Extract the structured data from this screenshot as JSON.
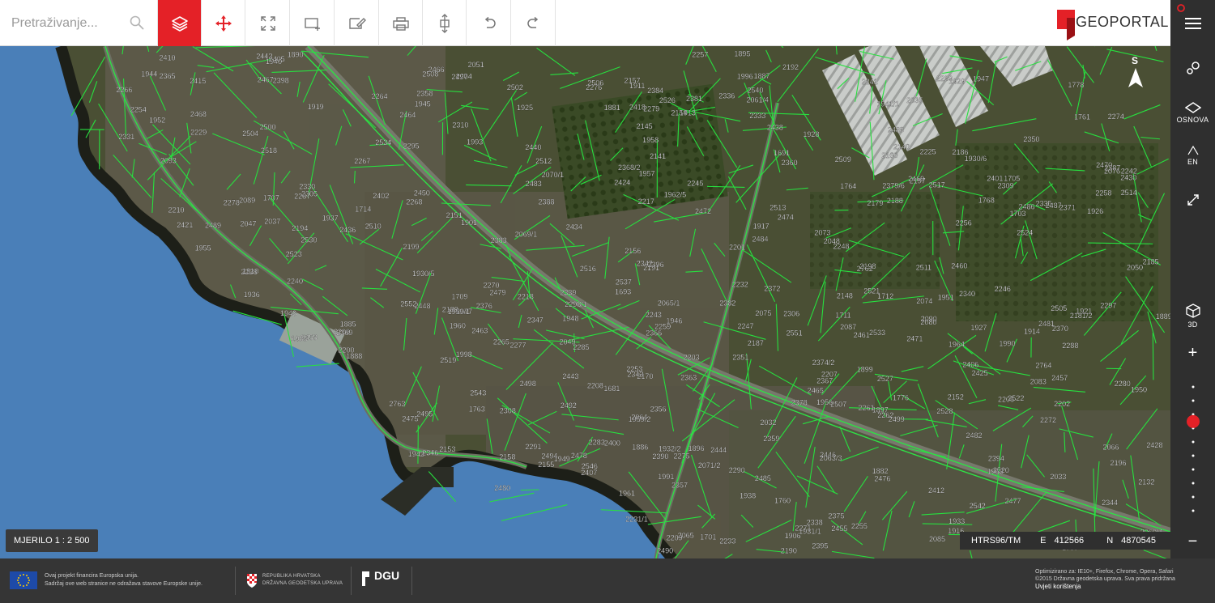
{
  "search": {
    "placeholder": "Pretraživanje..."
  },
  "toolbar": {
    "tools": [
      {
        "name": "layers",
        "active": true
      },
      {
        "name": "move"
      },
      {
        "name": "fullscreen"
      },
      {
        "name": "add-point"
      },
      {
        "name": "edit"
      },
      {
        "name": "print"
      },
      {
        "name": "measure"
      },
      {
        "name": "undo"
      },
      {
        "name": "redo"
      }
    ]
  },
  "logo": {
    "text": "GEOPORTAL",
    "accent": "#e42127"
  },
  "sidebar": {
    "north_label": "S",
    "osnova_label": "OSNOVA",
    "lang_label": "EN",
    "three_d_label": "3D",
    "zoom_in": "+",
    "zoom_out": "−",
    "zoom_level": 0.72
  },
  "map": {
    "scale_label": "MJERILO 1 : 2 500",
    "projection": "HTRS96/TM",
    "e_label": "E",
    "e_value": "412566",
    "n_label": "N",
    "n_value": "4870545",
    "parcel_labels": [
      "1895",
      "2154",
      "2179",
      "2155",
      "2148",
      "2145",
      "2140",
      "2141",
      "2132",
      "2158",
      "2093",
      "2090",
      "2089",
      "2087",
      "2085",
      "2083",
      "2080",
      "2077",
      "2076",
      "2075",
      "2074",
      "2073",
      "2071/2",
      "2070/1",
      "2069/1",
      "2066",
      "2061/4",
      "2049",
      "2048",
      "2047",
      "2051",
      "2050",
      "1966",
      "1964",
      "1963",
      "1961",
      "1958",
      "1957",
      "1952",
      "1948",
      "1943",
      "1944",
      "1939",
      "1940",
      "1933",
      "1929",
      "1928",
      "1927",
      "1926",
      "1925",
      "1921",
      "1919",
      "1917",
      "1916",
      "1914",
      "1913",
      "1911",
      "1910",
      "1906",
      "1901",
      "1899",
      "1896",
      "1897",
      "1887",
      "1888",
      "1889",
      "1890",
      "1881",
      "1882",
      "1885",
      "1886",
      "1938",
      "1937",
      "1936",
      "1930/5",
      "1932/2",
      "1931/1",
      "1930/6",
      "2170",
      "2160",
      "2157",
      "2156",
      "2153",
      "2152",
      "2151",
      "2181/2",
      "2185",
      "2186",
      "2187",
      "2188",
      "2189",
      "2190",
      "2191",
      "2192",
      "2194",
      "2196",
      "2197",
      "2198",
      "2199",
      "2200",
      "2201",
      "2202",
      "2203",
      "2204",
      "2205",
      "2206",
      "2207",
      "2208",
      "2209",
      "2210",
      "2217",
      "2218",
      "2225",
      "2228",
      "2229",
      "2231/1",
      "2232",
      "2233",
      "2240",
      "2241",
      "2242",
      "2243",
      "2244",
      "2245",
      "2246",
      "2247",
      "2248",
      "2253",
      "2254",
      "2255",
      "2256",
      "2257",
      "2258",
      "2259",
      "2261",
      "2262",
      "2264",
      "2265",
      "2266",
      "2267",
      "2268",
      "2270",
      "2271",
      "2272",
      "2274",
      "2275",
      "2276",
      "2277",
      "2278",
      "2279",
      "2280",
      "2283",
      "2285",
      "2287",
      "2288",
      "2290",
      "2291",
      "2293",
      "2295",
      "2297",
      "2298/1",
      "2301",
      "2305",
      "2306",
      "2308",
      "2309",
      "2310",
      "2330",
      "2331",
      "2333",
      "2335",
      "2336",
      "2338",
      "2339",
      "2340",
      "2342",
      "2343",
      "2344",
      "2346",
      "2347",
      "2350",
      "2351",
      "2356",
      "2357",
      "2358",
      "2359",
      "2360",
      "2363",
      "2365",
      "2366",
      "2367",
      "2368/2",
      "2369",
      "2370",
      "2371",
      "2372",
      "2374/2",
      "2375",
      "2376",
      "2378",
      "2379/6",
      "2381",
      "2382",
      "2383",
      "2384",
      "2387",
      "2388",
      "2390",
      "2394",
      "2395",
      "2396",
      "2398",
      "2400",
      "2401",
      "2402",
      "2405",
      "2406",
      "2407",
      "2410",
      "2412",
      "2415",
      "2418",
      "2421",
      "2424",
      "2425",
      "2428",
      "2430",
      "2432",
      "2434",
      "2436",
      "2438",
      "2440",
      "2442",
      "2443",
      "2444",
      "2446",
      "2448",
      "2450",
      "2455",
      "2457",
      "2458",
      "2460",
      "2461",
      "2463",
      "2464",
      "2465",
      "2466",
      "2467",
      "2468",
      "2469",
      "2470",
      "2471",
      "2472",
      "2474",
      "2475",
      "2476",
      "2477",
      "2478",
      "2479",
      "2480",
      "2481",
      "2482",
      "2483",
      "2484",
      "2485",
      "2486",
      "2487",
      "2488",
      "2489",
      "2490",
      "2492",
      "2494",
      "2495",
      "2497",
      "2498",
      "2499",
      "2500",
      "2502",
      "2504",
      "2505",
      "2506",
      "2507",
      "2508",
      "2509",
      "2510",
      "2511",
      "2512",
      "2513",
      "2514",
      "2516",
      "2517",
      "2518",
      "2519",
      "2520",
      "2521",
      "2522",
      "2523",
      "2524",
      "2526",
      "2527",
      "2528",
      "2530",
      "2533",
      "2534",
      "2537",
      "2540",
      "2542",
      "2543",
      "2546",
      "2551",
      "2552",
      "2762",
      "2763",
      "2764",
      "1681",
      "1691",
      "1693",
      "1701",
      "1703",
      "1705",
      "1707",
      "1709",
      "1711",
      "1712",
      "1714",
      "1760",
      "1761",
      "1763",
      "1764",
      "1768",
      "1776",
      "1778",
      "2031",
      "2032",
      "2033",
      "2035",
      "2037",
      "2060/4",
      "2062/3",
      "2063/3",
      "2064",
      "2065",
      "2065/1",
      "1951",
      "1955",
      "1985",
      "1990",
      "1991",
      "1993",
      "1996",
      "1998",
      "1947",
      "1945",
      "1941/1",
      "1942",
      "1949",
      "1956",
      "1959/1",
      "1959/2",
      "1962/5",
      "1960",
      "1946",
      "1950"
    ]
  },
  "footer": {
    "eu_line1": "Ovaj projekt financira Europska unija.",
    "eu_line2": "Sadržaj ove web stranice ne odražava stavove Europske unije.",
    "cro_line1": "REPUBLIKA HRVATSKA",
    "cro_line2": "DRŽAVNA GEODETSKA UPRAVA",
    "dgu": "DGU",
    "opt_line1": "Optimizirano za: IE10+, Firefox, Chrome, Opera, Safari",
    "opt_line2": "©2015 Državna geodetska uprava. Sva prava pridržana",
    "terms": "Uvjeti korištenja"
  }
}
